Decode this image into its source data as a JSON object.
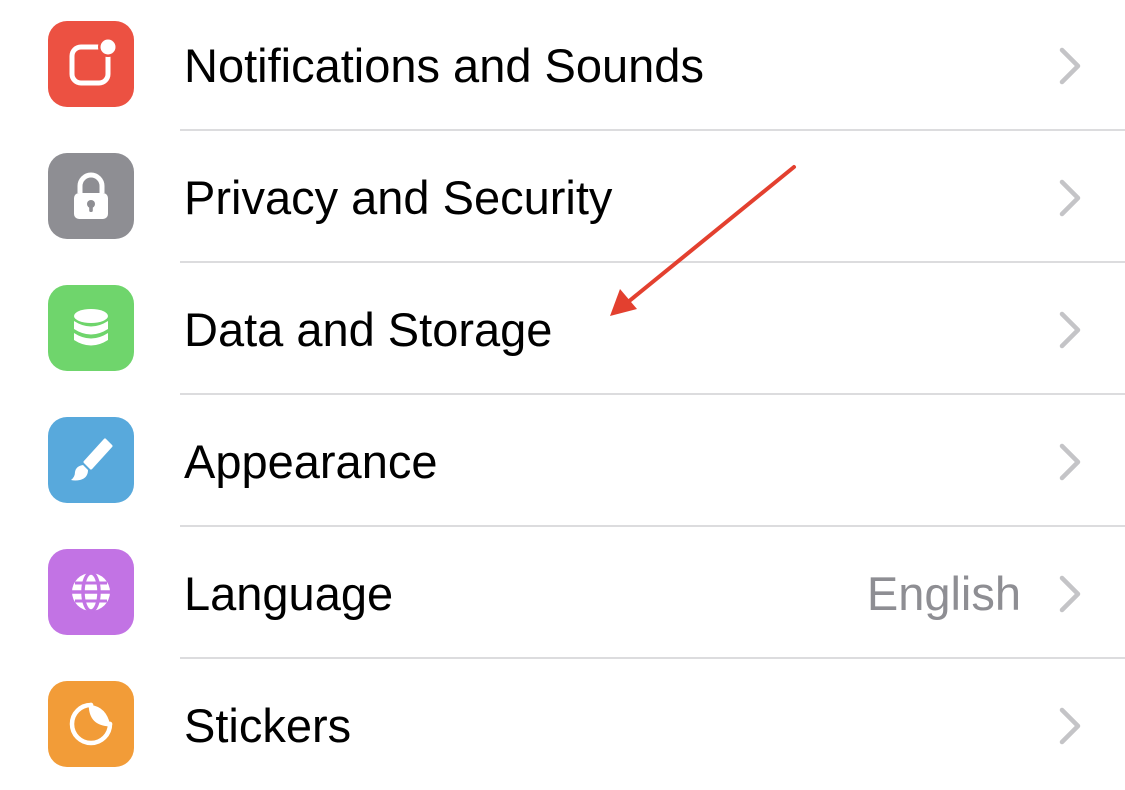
{
  "settings": {
    "items": [
      {
        "label": "Notifications and Sounds",
        "value": "",
        "icon": "notification-badge-icon",
        "color": "#ec5142"
      },
      {
        "label": "Privacy and Security",
        "value": "",
        "icon": "lock-icon",
        "color": "#8e8e93"
      },
      {
        "label": "Data and Storage",
        "value": "",
        "icon": "database-icon",
        "color": "#6fd56c"
      },
      {
        "label": "Appearance",
        "value": "",
        "icon": "paintbrush-icon",
        "color": "#58a9dc"
      },
      {
        "label": "Language",
        "value": "English",
        "icon": "globe-icon",
        "color": "#c273e4"
      },
      {
        "label": "Stickers",
        "value": "",
        "icon": "sticker-icon",
        "color": "#f29c38"
      }
    ]
  },
  "annotation": {
    "color": "#e3402f",
    "points_to": "Data and Storage"
  }
}
